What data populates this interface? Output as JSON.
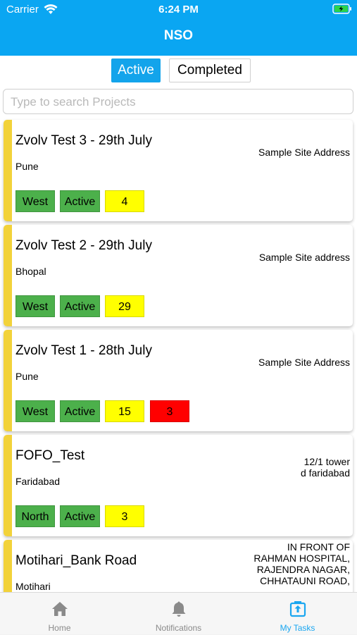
{
  "status_bar": {
    "carrier": "Carrier",
    "time": "6:24 PM"
  },
  "nav": {
    "title": "NSO"
  },
  "segments": {
    "active": "Active",
    "completed": "Completed"
  },
  "search": {
    "placeholder": "Type to search Projects"
  },
  "colors": {
    "header": "#0aa6f2",
    "stripe": "#f2d23a",
    "green_tag": "#4cb04b",
    "yellow_tag": "#ffff00",
    "red_tag": "#ff0000",
    "tab_active": "#1aa6f0"
  },
  "projects": [
    {
      "title": "Zvolv Test 3 - 29th July",
      "city": "Pune",
      "address": "Sample Site Address",
      "region": "West",
      "status": "Active",
      "count": "4"
    },
    {
      "title": "Zvolv Test 2 - 29th July",
      "city": "Bhopal",
      "address": "Sample Site address",
      "region": "West",
      "status": "Active",
      "count": "29"
    },
    {
      "title": "Zvolv Test 1 - 28th July",
      "city": "Pune",
      "address": "Sample Site Address",
      "region": "West",
      "status": "Active",
      "count": "15",
      "alert": "3"
    },
    {
      "title": "FOFO_Test",
      "city": "Faridabad",
      "address": "12/1 tower\nd faridabad",
      "region": "North",
      "status": "Active",
      "count": "3"
    },
    {
      "title": "Motihari_Bank Road",
      "city": "Motihari",
      "address": "IN FRONT OF\nRAHMAN HOSPITAL,\nRAJENDRA NAGAR,\nCHHATAUNI ROAD,",
      "region": "",
      "status": "",
      "count": ""
    }
  ],
  "tabbar": {
    "home": {
      "label": "Home",
      "icon": "home-icon"
    },
    "notifications": {
      "label": "Notifications",
      "icon": "bell-icon"
    },
    "tasks": {
      "label": "My Tasks",
      "icon": "tasks-icon"
    }
  }
}
